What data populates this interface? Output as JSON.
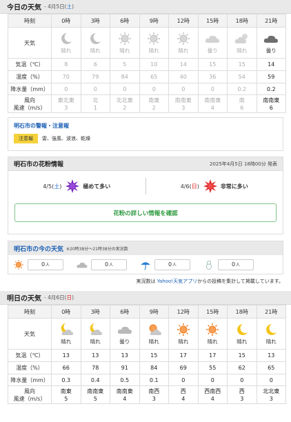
{
  "today": {
    "title": "今日の天気",
    "date_prefix": "- 4月5日(",
    "date_weekday": "土",
    "date_suffix": ")",
    "labels": {
      "time": "時刻",
      "weather": "天気",
      "temp": "気温（℃）",
      "humidity": "湿度（%）",
      "precip": "降水量（mm）",
      "wind_dir": "風向",
      "wind_speed": "風速（m/s）"
    },
    "columns": [
      {
        "time": "0時",
        "icon": "moon-icon",
        "cond": "晴れ",
        "temp": "8",
        "hum": "70",
        "precip": "0",
        "dir": "東北東",
        "speed": "3",
        "past": true
      },
      {
        "time": "3時",
        "icon": "moon-icon",
        "cond": "晴れ",
        "temp": "6",
        "hum": "79",
        "precip": "0",
        "dir": "北",
        "speed": "1",
        "past": true
      },
      {
        "time": "6時",
        "icon": "sun-icon",
        "cond": "晴れ",
        "temp": "5",
        "hum": "84",
        "precip": "0",
        "dir": "北北東",
        "speed": "2",
        "past": true
      },
      {
        "time": "9時",
        "icon": "sun-icon",
        "cond": "晴れ",
        "temp": "10",
        "hum": "65",
        "precip": "0",
        "dir": "南東",
        "speed": "2",
        "past": true
      },
      {
        "time": "12時",
        "icon": "sun-icon",
        "cond": "晴れ",
        "temp": "14",
        "hum": "40",
        "precip": "0",
        "dir": "南南東",
        "speed": "3",
        "past": true
      },
      {
        "time": "15時",
        "icon": "cloud-icon",
        "cond": "曇り",
        "temp": "15",
        "hum": "36",
        "precip": "0",
        "dir": "南南東",
        "speed": "4",
        "past": true
      },
      {
        "time": "18時",
        "icon": "cloud-sun-icon",
        "cond": "晴れ",
        "temp": "15",
        "hum": "54",
        "precip": "0.2",
        "dir": "南",
        "speed": "6",
        "past": true
      },
      {
        "time": "21時",
        "icon": "dark-cloud-icon",
        "cond": "曇り",
        "temp": "14",
        "hum": "59",
        "precip": "0.2",
        "dir": "南南東",
        "speed": "6",
        "past": false
      }
    ]
  },
  "warnings": {
    "title": "明石市の警報・注意報",
    "badge": "注意報",
    "items": "雷、強風、波浪、乾燥"
  },
  "pollen": {
    "title": "明石市の花粉情報",
    "issued": "2025年4月5日 18時00分 発表",
    "days": [
      {
        "prefix": "4/5(",
        "weekday": "土",
        "suffix": ")",
        "level": "極めて多い",
        "color": "#7b2bbf"
      },
      {
        "prefix": "4/6(",
        "weekday": "日",
        "suffix": ")",
        "level": "非常に多い",
        "color": "#e02828"
      }
    ],
    "button": "花粉の詳しい情報を確認"
  },
  "current": {
    "title": "明石市の今の天気",
    "subtitle": "※20時38分～21時38分の実況数",
    "items": [
      {
        "icon": "sun-icon",
        "count": "0",
        "unit": "人"
      },
      {
        "icon": "cloud-icon",
        "count": "0",
        "unit": "人"
      },
      {
        "icon": "umbrella-icon",
        "count": "0",
        "unit": "人"
      },
      {
        "icon": "snowman-icon",
        "count": "0",
        "unit": "人"
      }
    ],
    "note_pre": "実況数は ",
    "note_link": "Yahoo!天気アプリ",
    "note_post": "からの投稿を集計して掲載しています。"
  },
  "tomorrow": {
    "title": "明日の天気",
    "date_prefix": "- 4月6日(",
    "date_weekday": "日",
    "date_suffix": ")",
    "labels": {
      "time": "時刻",
      "weather": "天気",
      "temp": "気温（℃）",
      "humidity": "湿度（%）",
      "precip": "降水量（mm）",
      "wind_dir": "風向",
      "wind_speed": "風速（m/s）"
    },
    "columns": [
      {
        "time": "0時",
        "icon": "moon-cloud-icon",
        "cond": "晴れ",
        "temp": "13",
        "hum": "66",
        "precip": "0.3",
        "dir": "南東",
        "speed": "5"
      },
      {
        "time": "3時",
        "icon": "moon-cloud-icon",
        "cond": "晴れ",
        "temp": "13",
        "hum": "78",
        "precip": "0.4",
        "dir": "南南東",
        "speed": "5"
      },
      {
        "time": "6時",
        "icon": "cloud-icon",
        "cond": "曇り",
        "temp": "13",
        "hum": "91",
        "precip": "0.5",
        "dir": "南南東",
        "speed": "4"
      },
      {
        "time": "9時",
        "icon": "sun-cloud-icon",
        "cond": "晴れ",
        "temp": "15",
        "hum": "84",
        "precip": "0.1",
        "dir": "南西",
        "speed": "3"
      },
      {
        "time": "12時",
        "icon": "sun-icon",
        "cond": "晴れ",
        "temp": "17",
        "hum": "69",
        "precip": "0",
        "dir": "西",
        "speed": "4"
      },
      {
        "time": "15時",
        "icon": "sun-icon",
        "cond": "晴れ",
        "temp": "17",
        "hum": "55",
        "precip": "0",
        "dir": "西南西",
        "speed": "4"
      },
      {
        "time": "18時",
        "icon": "moon-icon",
        "cond": "晴れ",
        "temp": "15",
        "hum": "62",
        "precip": "0",
        "dir": "西",
        "speed": "3"
      },
      {
        "time": "21時",
        "icon": "moon-icon",
        "cond": "晴れ",
        "temp": "13",
        "hum": "65",
        "precip": "0",
        "dir": "北北東",
        "speed": "3"
      }
    ]
  }
}
